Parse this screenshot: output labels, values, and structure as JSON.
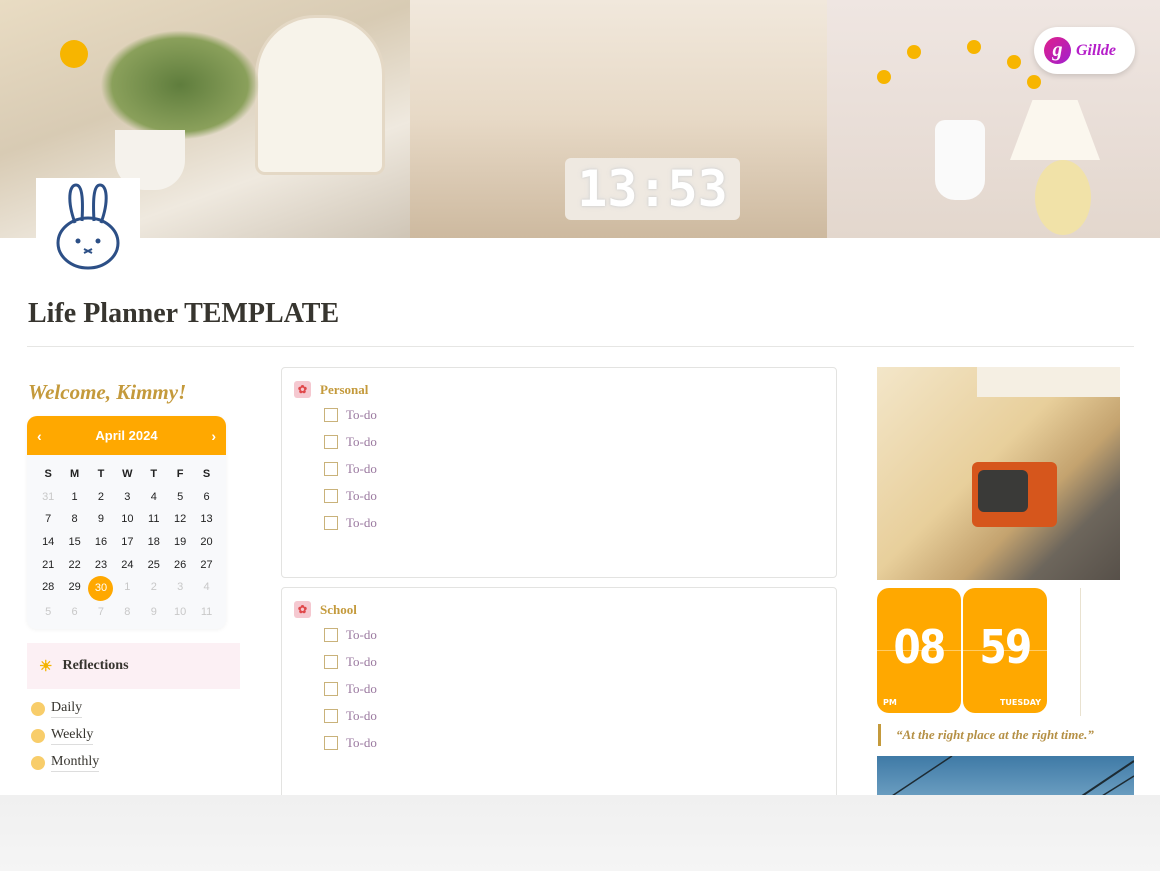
{
  "banner": {
    "photo_clock": "13:53",
    "logo_text": "Gillde",
    "logo_mark": "g"
  },
  "page": {
    "title": "Life Planner TEMPLATE",
    "icon": "bunny-icon"
  },
  "welcome": "Welcome, Kimmy!",
  "calendar": {
    "month": "April 2024",
    "prev": "‹",
    "next": "›",
    "accent": "#FFA800",
    "weekdays": [
      "S",
      "M",
      "T",
      "W",
      "T",
      "F",
      "S"
    ],
    "days": [
      [
        {
          "d": "31",
          "m": true
        },
        {
          "d": "1"
        },
        {
          "d": "2"
        },
        {
          "d": "3"
        },
        {
          "d": "4"
        },
        {
          "d": "5"
        },
        {
          "d": "6"
        }
      ],
      [
        {
          "d": "7"
        },
        {
          "d": "8"
        },
        {
          "d": "9"
        },
        {
          "d": "10"
        },
        {
          "d": "11"
        },
        {
          "d": "12"
        },
        {
          "d": "13"
        }
      ],
      [
        {
          "d": "14"
        },
        {
          "d": "15"
        },
        {
          "d": "16"
        },
        {
          "d": "17"
        },
        {
          "d": "18"
        },
        {
          "d": "19"
        },
        {
          "d": "20"
        }
      ],
      [
        {
          "d": "21"
        },
        {
          "d": "22"
        },
        {
          "d": "23"
        },
        {
          "d": "24"
        },
        {
          "d": "25"
        },
        {
          "d": "26"
        },
        {
          "d": "27"
        }
      ],
      [
        {
          "d": "28"
        },
        {
          "d": "29"
        },
        {
          "d": "30",
          "today": true
        },
        {
          "d": "1",
          "m": true
        },
        {
          "d": "2",
          "m": true
        },
        {
          "d": "3",
          "m": true
        },
        {
          "d": "4",
          "m": true
        }
      ],
      [
        {
          "d": "5",
          "m": true
        },
        {
          "d": "6",
          "m": true
        },
        {
          "d": "7",
          "m": true
        },
        {
          "d": "8",
          "m": true
        },
        {
          "d": "9",
          "m": true
        },
        {
          "d": "10",
          "m": true
        },
        {
          "d": "11",
          "m": true
        }
      ]
    ]
  },
  "reflections": {
    "title": "Reflections",
    "icon": "sun-icon",
    "items": [
      "Daily",
      "Weekly",
      "Monthly"
    ]
  },
  "lists": [
    {
      "title": "Personal",
      "items": [
        "To-do",
        "To-do",
        "To-do",
        "To-do",
        "To-do"
      ]
    },
    {
      "title": "School",
      "items": [
        "To-do",
        "To-do",
        "To-do",
        "To-do",
        "To-do"
      ]
    }
  ],
  "clock": {
    "hour": "08",
    "minute": "59",
    "ampm": "PM",
    "day": "TUESDAY"
  },
  "quote": "“At the right place at the right time.”"
}
